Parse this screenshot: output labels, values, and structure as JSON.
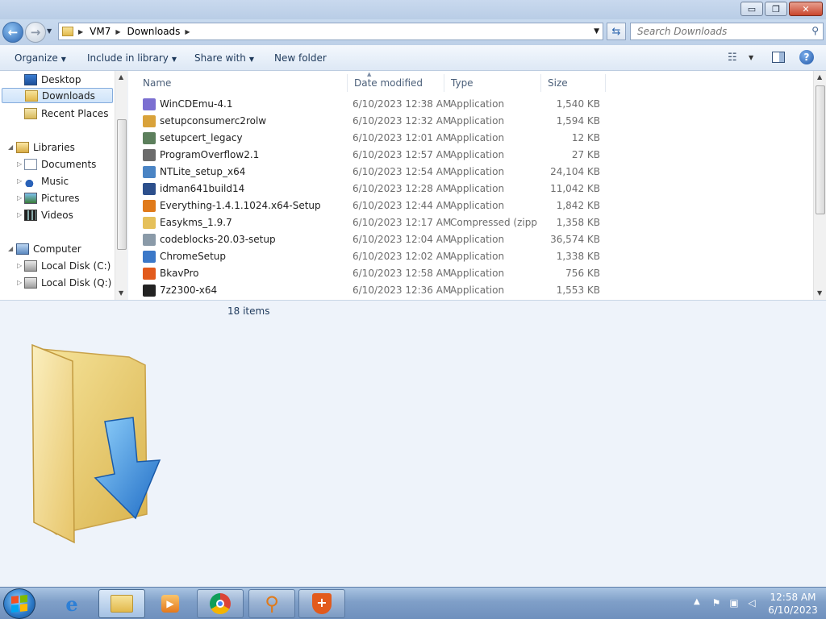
{
  "window": {
    "minimize": "▭",
    "maximize": "❐",
    "close": "✕"
  },
  "address": {
    "path": [
      "VM7",
      "Downloads"
    ],
    "search_placeholder": "Search Downloads"
  },
  "toolbar": {
    "organize": "Organize",
    "include_in_library": "Include in library",
    "share_with": "Share with",
    "new_folder": "New folder"
  },
  "nav": {
    "favorites": [
      "Desktop",
      "Downloads",
      "Recent Places"
    ],
    "libraries_label": "Libraries",
    "libraries": [
      "Documents",
      "Music",
      "Pictures",
      "Videos"
    ],
    "computer_label": "Computer",
    "drives": [
      "Local Disk (C:)",
      "Local Disk (Q:)"
    ],
    "selected": "Downloads"
  },
  "columns": {
    "name": "Name",
    "date": "Date modified",
    "type": "Type",
    "size": "Size"
  },
  "files": [
    {
      "name": "WinCDEmu-4.1",
      "date": "6/10/2023 12:38 AM",
      "type": "Application",
      "size": "1,540 KB",
      "icon": "cd-icon",
      "color": "#7b6fd1"
    },
    {
      "name": "setupconsumerc2rolw",
      "date": "6/10/2023 12:32 AM",
      "type": "Application",
      "size": "1,594 KB",
      "icon": "installer-icon",
      "color": "#d9a23a"
    },
    {
      "name": "setupcert_legacy",
      "date": "6/10/2023 12:01 AM",
      "type": "Application",
      "size": "12 KB",
      "icon": "window-icon",
      "color": "#5c7f5c"
    },
    {
      "name": "ProgramOverflow2.1",
      "date": "6/10/2023 12:57 AM",
      "type": "Application",
      "size": "27 KB",
      "icon": "gear-icon",
      "color": "#6b6b6b"
    },
    {
      "name": "NTLite_setup_x64",
      "date": "6/10/2023 12:54 AM",
      "type": "Application",
      "size": "24,104 KB",
      "icon": "download-icon",
      "color": "#4a84c4"
    },
    {
      "name": "idman641build14",
      "date": "6/10/2023 12:28 AM",
      "type": "Application",
      "size": "11,042 KB",
      "icon": "idm-icon",
      "color": "#2c4f8c"
    },
    {
      "name": "Everything-1.4.1.1024.x64-Setup",
      "date": "6/10/2023 12:44 AM",
      "type": "Application",
      "size": "1,842 KB",
      "icon": "magnifier-icon",
      "color": "#e07a1a"
    },
    {
      "name": "Easykms_1.9.7",
      "date": "6/10/2023 12:17 AM",
      "type": "Compressed (zipp...",
      "size": "1,358 KB",
      "icon": "zip-folder-icon",
      "color": "#e5c05a"
    },
    {
      "name": "codeblocks-20.03-setup",
      "date": "6/10/2023 12:04 AM",
      "type": "Application",
      "size": "36,574 KB",
      "icon": "codeblocks-icon",
      "color": "#8a9aa8"
    },
    {
      "name": "ChromeSetup",
      "date": "6/10/2023 12:02 AM",
      "type": "Application",
      "size": "1,338 KB",
      "icon": "window-icon",
      "color": "#3b78c8"
    },
    {
      "name": "BkavPro",
      "date": "6/10/2023 12:58 AM",
      "type": "Application",
      "size": "756 KB",
      "icon": "shield-icon",
      "color": "#e25a1c"
    },
    {
      "name": "7z2300-x64",
      "date": "6/10/2023 12:36 AM",
      "type": "Application",
      "size": "1,553 KB",
      "icon": "7zip-icon",
      "color": "#222222"
    }
  ],
  "status": {
    "item_count": "18 items"
  },
  "taskbar": {
    "time": "12:58 AM",
    "date": "6/10/2023"
  }
}
